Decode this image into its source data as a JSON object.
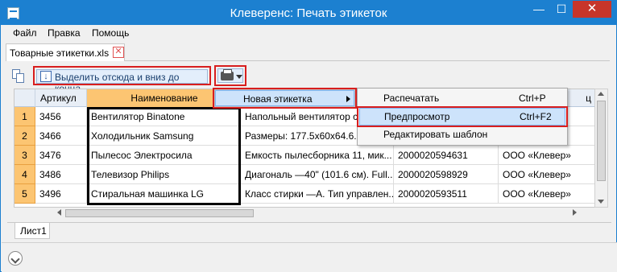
{
  "window": {
    "title": "Клеверенс: Печать этикеток",
    "minimize": "—",
    "maximize": "☐",
    "close": "✕"
  },
  "menubar": [
    "Файл",
    "Правка",
    "Помощь"
  ],
  "document_tab": {
    "label": "Товарные этикетки.xls",
    "close": "✕"
  },
  "toolbar": {
    "select_button_label": "Выделить отсюда и вниз до конца"
  },
  "grid": {
    "columns": [
      "Артикул",
      "Наименование",
      "",
      "",
      "ц"
    ],
    "rows": [
      {
        "num": "1",
        "article": "3456",
        "name": "Вентилятор Binatone",
        "desc": "Напольный вентилятор с",
        "barcode": "",
        "maker": ""
      },
      {
        "num": "2",
        "article": "3466",
        "name": "Холодильник Samsung",
        "desc": "Размеры: 177.5x60x64.6. О",
        "barcode": "",
        "maker": ""
      },
      {
        "num": "3",
        "article": "3476",
        "name": "Пылесос Электросила",
        "desc": "Емкость пылесборника 11, мик...",
        "barcode": "2000020594631",
        "maker": "ООО «Клевер»"
      },
      {
        "num": "4",
        "article": "3486",
        "name": "Телевизор Philips",
        "desc": "Диагональ —40\" (101.6 см). Full...",
        "barcode": "2000020598929",
        "maker": "ООО «Клевер»"
      },
      {
        "num": "5",
        "article": "3496",
        "name": "Стиральная машинка LG",
        "desc": "Класс стирки —А. Тип управлен...",
        "barcode": "2000020593511",
        "maker": "ООО «Клевер»"
      }
    ]
  },
  "sheet_tab": "Лист1",
  "context_menu": {
    "item": "Новая этикетка"
  },
  "submenu": [
    {
      "label": "Распечатать",
      "shortcut": "Ctrl+P"
    },
    {
      "label": "Предпросмотр",
      "shortcut": "Ctrl+F2"
    },
    {
      "label": "Редактировать шаблон",
      "shortcut": ""
    }
  ],
  "colors": {
    "titlebar": "#1c80d0",
    "header_active": "#fcc572",
    "highlight_red": "#d81e1e",
    "menu_hover": "#cde3fb"
  },
  "icons": [
    "app-icon",
    "copy-icon",
    "select-down-icon",
    "printer-icon",
    "chevron-down-icon",
    "submenu-arrow-icon",
    "expand-icon"
  ]
}
